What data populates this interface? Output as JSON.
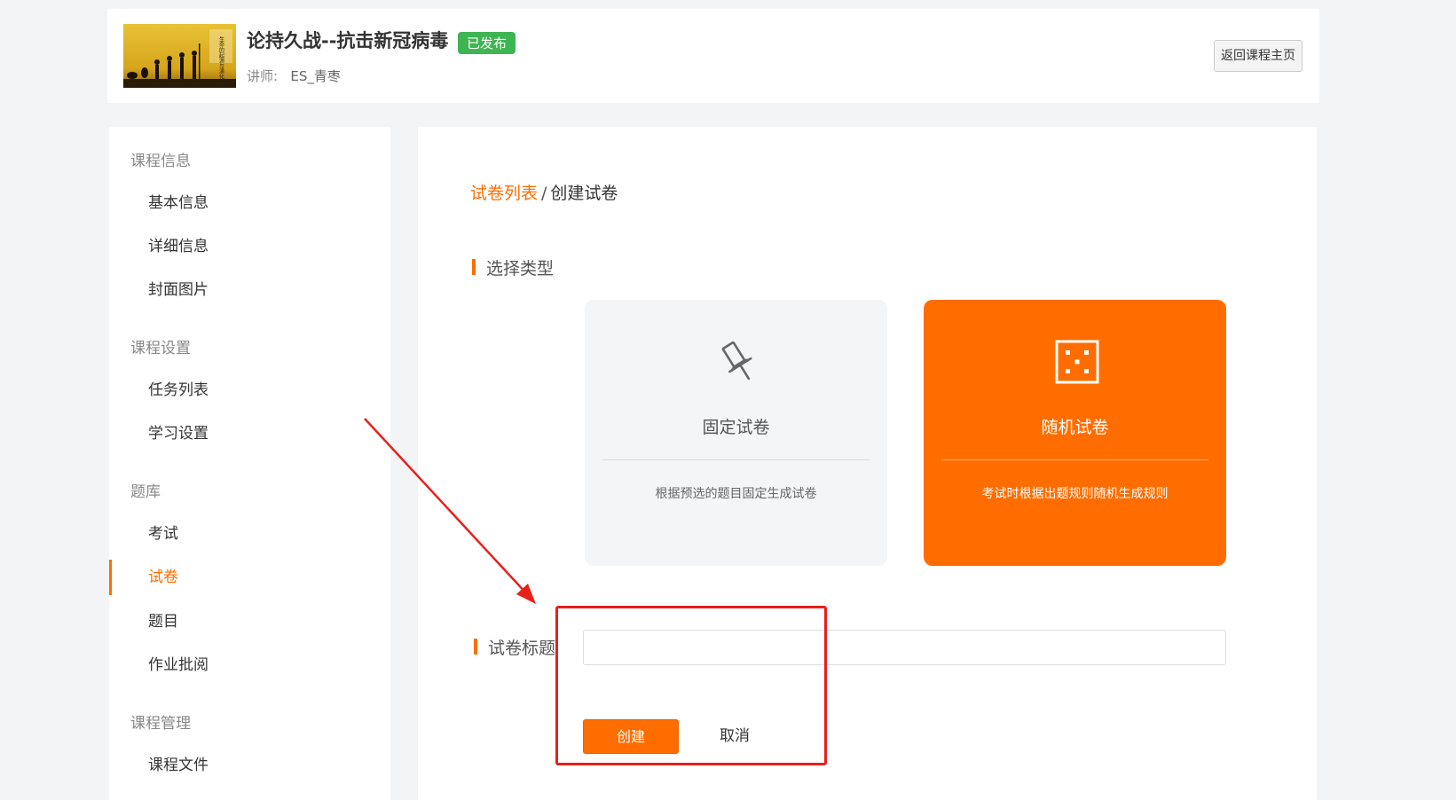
{
  "header": {
    "cover_caption": "生命的起源与演化",
    "course_title": "论持久战--抗击新冠病毒",
    "status_badge": "已发布",
    "teacher_label": "讲师:",
    "teacher_name": "ES_青枣",
    "back_button": "返回课程主页"
  },
  "sidebar": {
    "groups": [
      {
        "label": "课程信息",
        "items": [
          {
            "label": "基本信息"
          },
          {
            "label": "详细信息"
          },
          {
            "label": "封面图片"
          }
        ]
      },
      {
        "label": "课程设置",
        "items": [
          {
            "label": "任务列表"
          },
          {
            "label": "学习设置"
          }
        ]
      },
      {
        "label": "题库",
        "items": [
          {
            "label": "考试"
          },
          {
            "label": "试卷",
            "active": true
          },
          {
            "label": "题目"
          },
          {
            "label": "作业批阅"
          }
        ]
      },
      {
        "label": "课程管理",
        "items": [
          {
            "label": "课程文件"
          }
        ]
      }
    ]
  },
  "main": {
    "breadcrumb": {
      "link": "试卷列表",
      "separator": "/",
      "current": "创建试卷"
    },
    "type_section_title": "选择类型",
    "type_cards": [
      {
        "name": "固定试卷",
        "description": "根据预选的题目固定生成试卷",
        "icon": "pushpin-icon",
        "selected": false
      },
      {
        "name": "随机试卷",
        "description": "考试时根据出题规则随机生成规则",
        "icon": "dice-icon",
        "selected": true
      }
    ],
    "title_field_label": "试卷标题",
    "title_input_value": "",
    "create_button": "创建",
    "cancel_button": "取消"
  },
  "colors": {
    "accent": "#ff6d00",
    "badge_green": "#3db551",
    "annotation_red": "#e8201c"
  }
}
